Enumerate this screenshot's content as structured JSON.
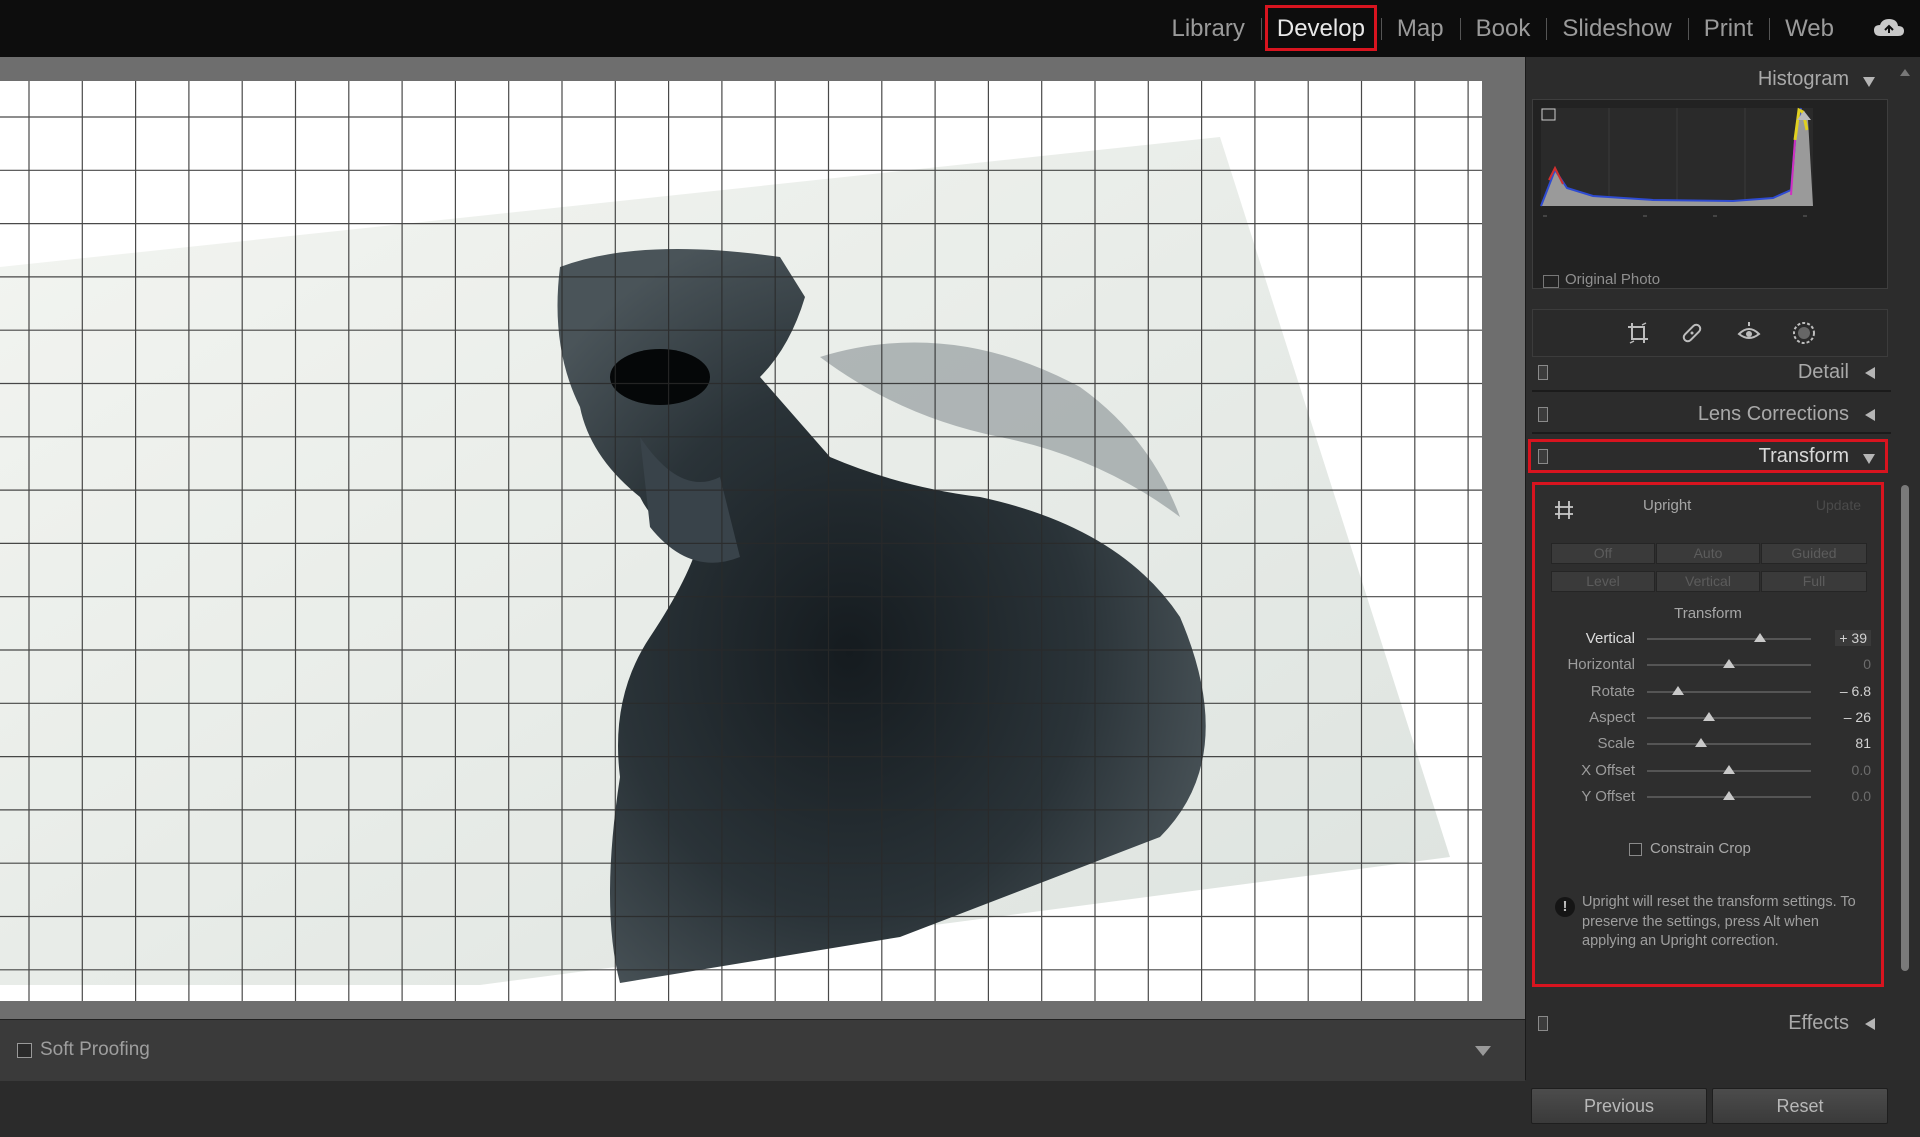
{
  "app": {
    "accent": "#d8141f"
  },
  "modules": [
    {
      "label": "Library"
    },
    {
      "label": "Develop",
      "active": true
    },
    {
      "label": "Map"
    },
    {
      "label": "Book"
    },
    {
      "label": "Slideshow"
    },
    {
      "label": "Print"
    },
    {
      "label": "Web"
    }
  ],
  "panels": {
    "histogram": {
      "title": "Histogram",
      "original_photo_label": "Original Photo"
    },
    "detail": {
      "title": "Detail"
    },
    "lens": {
      "title": "Lens Corrections"
    },
    "transform": {
      "title": "Transform",
      "upright_label": "Upright",
      "update_label": "Update",
      "upright_buttons": [
        "Off",
        "Auto",
        "Guided",
        "Level",
        "Vertical",
        "Full"
      ],
      "section_label": "Transform",
      "sliders": [
        {
          "label": "Vertical",
          "value": "+ 39",
          "fraction": 0.69
        },
        {
          "label": "Horizontal",
          "value": "0",
          "fraction": 0.5
        },
        {
          "label": "Rotate",
          "value": "– 6.8",
          "fraction": 0.19
        },
        {
          "label": "Aspect",
          "value": "– 26",
          "fraction": 0.38
        },
        {
          "label": "Scale",
          "value": "81",
          "fraction": 0.33
        },
        {
          "label": "X Offset",
          "value": "0.0",
          "fraction": 0.5
        },
        {
          "label": "Y Offset",
          "value": "0.0",
          "fraction": 0.5
        }
      ],
      "constrain_crop_label": "Constrain Crop",
      "info_text": "Upright will reset the transform settings. To preserve the settings, press Alt when applying an Upright correction."
    },
    "effects": {
      "title": "Effects"
    }
  },
  "toolbar": {
    "soft_proofing_label": "Soft Proofing"
  },
  "buttons": {
    "previous": "Previous",
    "reset": "Reset"
  },
  "icons": {
    "cloud": "cloud-sync-icon",
    "tools": [
      "crop-icon",
      "healing-brush-icon",
      "red-eye-icon",
      "masking-icon"
    ]
  }
}
